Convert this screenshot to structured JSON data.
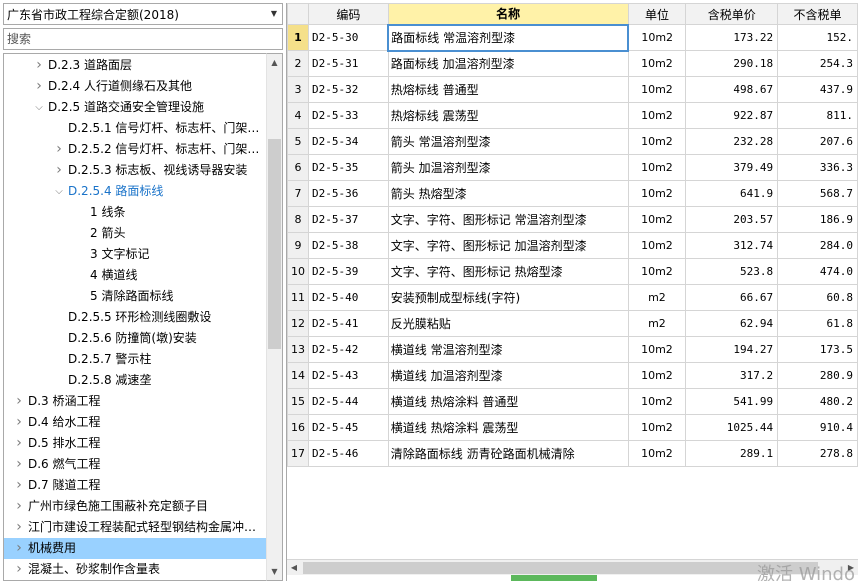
{
  "left_panel": {
    "db_select": {
      "value": "广东省市政工程综合定额(2018)"
    },
    "search": {
      "placeholder": "搜索"
    },
    "tree": [
      {
        "label": "D.2.3 道路面层",
        "indent": 1,
        "toggle": "collapsed"
      },
      {
        "label": "D.2.4 人行道侧缘石及其他",
        "indent": 1,
        "toggle": "collapsed"
      },
      {
        "label": "D.2.5 道路交通安全管理设施",
        "indent": 1,
        "toggle": "expanded"
      },
      {
        "label": "D.2.5.1 信号灯杆、标志杆、门架…",
        "indent": 2,
        "toggle": "none"
      },
      {
        "label": "D.2.5.2 信号灯杆、标志杆、门架…",
        "indent": 2,
        "toggle": "collapsed"
      },
      {
        "label": "D.2.5.3 标志板、视线诱导器安装",
        "indent": 2,
        "toggle": "collapsed"
      },
      {
        "label": "D.2.5.4 路面标线",
        "indent": 2,
        "toggle": "expanded",
        "active": true
      },
      {
        "label": "1 线条",
        "indent": 3,
        "toggle": "none"
      },
      {
        "label": "2 箭头",
        "indent": 3,
        "toggle": "none"
      },
      {
        "label": "3 文字标记",
        "indent": 3,
        "toggle": "none"
      },
      {
        "label": "4 横道线",
        "indent": 3,
        "toggle": "none"
      },
      {
        "label": "5 清除路面标线",
        "indent": 3,
        "toggle": "none"
      },
      {
        "label": "D.2.5.5 环形检测线圈敷设",
        "indent": 2,
        "toggle": "none"
      },
      {
        "label": "D.2.5.6 防撞筒(墩)安装",
        "indent": 2,
        "toggle": "none"
      },
      {
        "label": "D.2.5.7 警示柱",
        "indent": 2,
        "toggle": "none"
      },
      {
        "label": "D.2.5.8 减速垄",
        "indent": 2,
        "toggle": "none"
      },
      {
        "label": "D.3 桥涵工程",
        "indent": 0,
        "toggle": "collapsed"
      },
      {
        "label": "D.4 给水工程",
        "indent": 0,
        "toggle": "collapsed"
      },
      {
        "label": "D.5 排水工程",
        "indent": 0,
        "toggle": "collapsed"
      },
      {
        "label": "D.6 燃气工程",
        "indent": 0,
        "toggle": "collapsed"
      },
      {
        "label": "D.7 隧道工程",
        "indent": 0,
        "toggle": "collapsed"
      },
      {
        "label": "广州市绿色施工围蔽补充定额子目",
        "indent": 0,
        "toggle": "collapsed"
      },
      {
        "label": "江门市建设工程装配式轻型钢结构金属冲…",
        "indent": 0,
        "toggle": "collapsed"
      },
      {
        "label": "机械费用",
        "indent": 0,
        "toggle": "collapsed",
        "selected": true
      },
      {
        "label": "混凝土、砂浆制作含量表",
        "indent": 0,
        "toggle": "collapsed"
      }
    ]
  },
  "grid": {
    "headers": {
      "code": "编码",
      "name": "名称",
      "unit": "单位",
      "tax_price": "含税单价",
      "notax_price": "不含税单"
    },
    "rows": [
      {
        "idx": "1",
        "code": "D2-5-30",
        "name": "路面标线 常温溶剂型漆",
        "unit": "10m2",
        "tax_price": "173.22",
        "notax_price": "152."
      },
      {
        "idx": "2",
        "code": "D2-5-31",
        "name": "路面标线 加温溶剂型漆",
        "unit": "10m2",
        "tax_price": "290.18",
        "notax_price": "254.3"
      },
      {
        "idx": "3",
        "code": "D2-5-32",
        "name": "热熔标线 普通型",
        "unit": "10m2",
        "tax_price": "498.67",
        "notax_price": "437.9"
      },
      {
        "idx": "4",
        "code": "D2-5-33",
        "name": "热熔标线 震荡型",
        "unit": "10m2",
        "tax_price": "922.87",
        "notax_price": "811."
      },
      {
        "idx": "5",
        "code": "D2-5-34",
        "name": "箭头 常温溶剂型漆",
        "unit": "10m2",
        "tax_price": "232.28",
        "notax_price": "207.6"
      },
      {
        "idx": "6",
        "code": "D2-5-35",
        "name": "箭头 加温溶剂型漆",
        "unit": "10m2",
        "tax_price": "379.49",
        "notax_price": "336.3"
      },
      {
        "idx": "7",
        "code": "D2-5-36",
        "name": "箭头 热熔型漆",
        "unit": "10m2",
        "tax_price": "641.9",
        "notax_price": "568.7"
      },
      {
        "idx": "8",
        "code": "D2-5-37",
        "name": "文字、字符、图形标记 常温溶剂型漆",
        "unit": "10m2",
        "tax_price": "203.57",
        "notax_price": "186.9"
      },
      {
        "idx": "9",
        "code": "D2-5-38",
        "name": "文字、字符、图形标记 加温溶剂型漆",
        "unit": "10m2",
        "tax_price": "312.74",
        "notax_price": "284.0"
      },
      {
        "idx": "10",
        "code": "D2-5-39",
        "name": "文字、字符、图形标记 热熔型漆",
        "unit": "10m2",
        "tax_price": "523.8",
        "notax_price": "474.0"
      },
      {
        "idx": "11",
        "code": "D2-5-40",
        "name": "安装预制成型标线(字符)",
        "unit": "m2",
        "tax_price": "66.67",
        "notax_price": "60.8"
      },
      {
        "idx": "12",
        "code": "D2-5-41",
        "name": "反光膜粘贴",
        "unit": "m2",
        "tax_price": "62.94",
        "notax_price": "61.8"
      },
      {
        "idx": "13",
        "code": "D2-5-42",
        "name": "横道线 常温溶剂型漆",
        "unit": "10m2",
        "tax_price": "194.27",
        "notax_price": "173.5"
      },
      {
        "idx": "14",
        "code": "D2-5-43",
        "name": "横道线 加温溶剂型漆",
        "unit": "10m2",
        "tax_price": "317.2",
        "notax_price": "280.9"
      },
      {
        "idx": "15",
        "code": "D2-5-44",
        "name": "横道线 热熔涂料 普通型",
        "unit": "10m2",
        "tax_price": "541.99",
        "notax_price": "480.2"
      },
      {
        "idx": "16",
        "code": "D2-5-45",
        "name": "横道线 热熔涂料 震荡型",
        "unit": "10m2",
        "tax_price": "1025.44",
        "notax_price": "910.4"
      },
      {
        "idx": "17",
        "code": "D2-5-46",
        "name": "清除路面标线 沥青砼路面机械清除",
        "unit": "10m2",
        "tax_price": "289.1",
        "notax_price": "278.8"
      }
    ]
  },
  "watermark": {
    "text": "激活 Windo"
  },
  "colors": {
    "selected_row": "#99d1ff",
    "active_text": "#1a73c9",
    "header_highlight": "#fff2a8",
    "focus_border": "#4a8fd1"
  }
}
